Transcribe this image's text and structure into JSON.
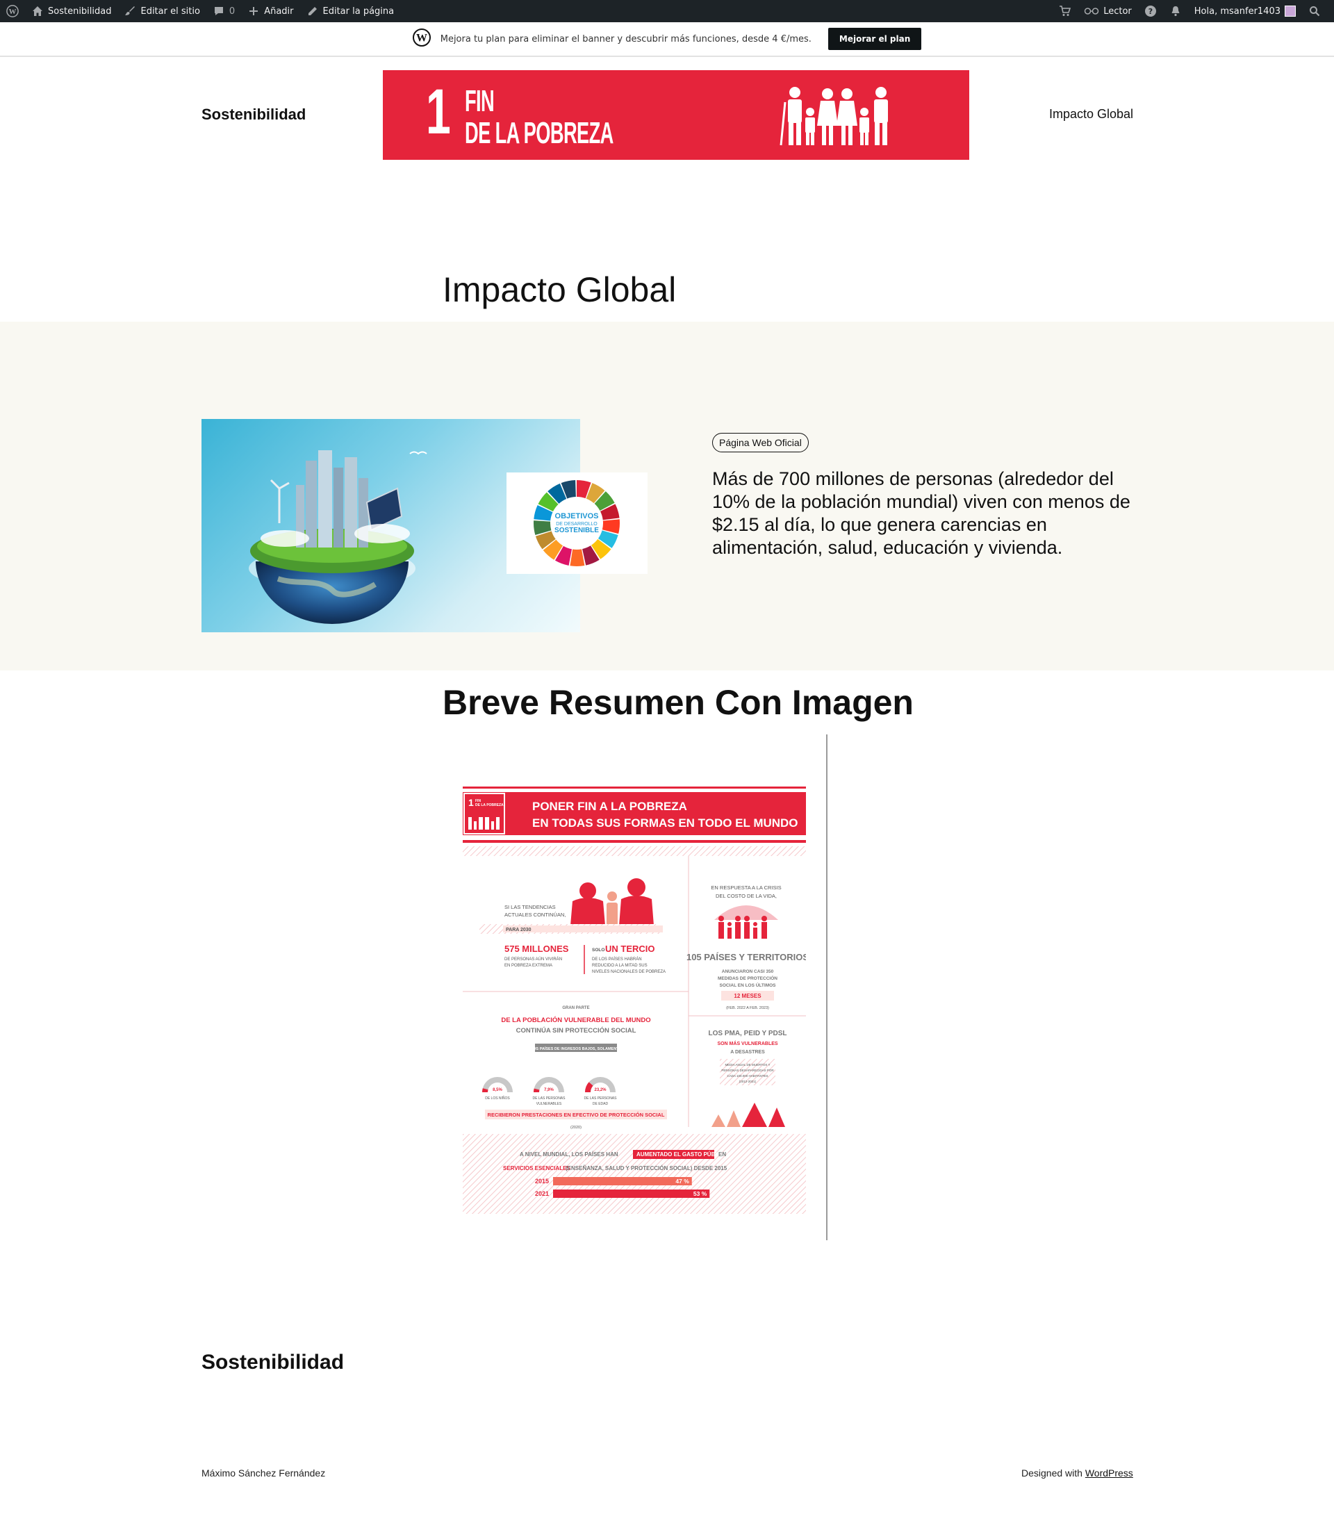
{
  "admin_bar": {
    "site": "Sostenibilidad",
    "edit_site": "Editar el sitio",
    "comments_count": "0",
    "add_new": "Añadir",
    "edit_page": "Editar la página",
    "reader": "Lector",
    "greeting": "Hola, msanfer1403"
  },
  "upgrade_banner": {
    "text": "Mejora tu plan para eliminar el banner y descubrir más funciones, desde 4 €/mes.",
    "button": "Mejorar el plan"
  },
  "header": {
    "site_title": "Sostenibilidad",
    "banner_number": "1",
    "banner_line1": "FIN",
    "banner_line2": "DE LA POBREZA",
    "banner_color": "#e5243b",
    "nav_link": "Impacto Global"
  },
  "page": {
    "title": "Impacto Global",
    "badge": "Página Web Oficial",
    "lead": "Más de 700 millones de personas (alrededor del 10% de la población mundial) viven con menos de $2.15 al día, lo que genera carencias en alimentación, salud, educación y vivienda.",
    "sdg_logo_line1": "OBJETIVOS",
    "sdg_logo_line2": "DE DESARROLLO",
    "sdg_logo_line3": "SOSTENIBLE"
  },
  "section2": {
    "title": "Breve Resumen Con Imagen"
  },
  "infographic": {
    "badge_num": "1",
    "badge_line1": "FIN",
    "badge_line2": "DE LA POBREZA",
    "header_line1": "PONER FIN A LA POBREZA",
    "header_line2": "EN TODAS SUS FORMAS EN TODO EL MUNDO",
    "trend_line1": "SI LAS TENDENCIAS",
    "trend_line2": "ACTUALES CONTINÚAN,",
    "para_2030": "PARA 2030",
    "million_575": "575 MILLONES",
    "million_575_sub1": "DE PERSONAS AÚN VIVIRÁN",
    "million_575_sub2": "EN POBREZA EXTREMA",
    "solo": "SOLO",
    "tercio": "UN TERCIO",
    "tercio_sub1": "DE LOS PAÍSES HABRÁN",
    "tercio_sub2": "REDUCIDO A LA MITAD SUS",
    "tercio_sub3": "NIVELES NACIONALES DE POBREZA",
    "crisis_line1": "EN RESPUESTA A LA CRISIS",
    "crisis_line2": "DEL COSTO DE LA VIDA,",
    "countries": "105 PAÍSES Y TERRITORIOS",
    "measures1": "ANUNCIARON  CASI  350",
    "measures2": "MEDIDAS DE PROTECCIÓN",
    "measures3": "SOCIAL  EN  LOS  ÚLTIMOS",
    "months": "12 MESES",
    "months_period": "(FEB. 2022 A FEB. 2023)",
    "gran_parte": "GRAN PARTE",
    "vulnerable_line1": "DE LA POBLACIÓN VULNERABLE DEL MUNDO",
    "vulnerable_line2": "CONTINÚA SIN PROTECCIÓN SOCIAL",
    "low_income": "LOS PAÍSES DE INGRESOS BAJOS, SOLAMENTE",
    "gauges": [
      {
        "value": "8,5%",
        "label": "DE LOS NIÑOS",
        "fraction": 0.085
      },
      {
        "value": "7,9%",
        "label": "DE LAS PERSONAS VULNERABLES",
        "fraction": 0.079
      },
      {
        "value": "23,2%",
        "label": "DE LAS PERSONAS DE EDAD",
        "fraction": 0.232
      }
    ],
    "received": "RECIBIERON PRESTACIONES EN EFECTIVO DE PROTECCIÓN SOCIAL",
    "received_year": "(2020)",
    "pma_line1": "LOS PMA, PEID Y PDSL",
    "pma_line2": "SON MÁS VULNERABLES",
    "pma_line3": "A DESASTRES",
    "pma_note1": "MEDIA ANUAL DE MUERTOS Y",
    "pma_note2": "PERSONAS DESAPARECIDAS POR",
    "pma_note3": "CADA 100.000 HABITANTES",
    "pma_note4": "(2012-2021)",
    "spending_line1a": "A NIVEL MUNDIAL, LOS PAÍSES HAN",
    "spending_highlight": "AUMENTADO EL GASTO PÚBLICO",
    "spending_line1b": "EN",
    "spending_line2a": "SERVICIOS ESENCIALES",
    "spending_line2b": "(ENSEÑANZA, SALUD Y PROTECCIÓN SOCIAL) DESDE 2015",
    "bars": [
      {
        "year": "2015",
        "value": "47 %",
        "pct": 47
      },
      {
        "year": "2021",
        "value": "53 %",
        "pct": 53
      }
    ]
  },
  "footer": {
    "title": "Sostenibilidad",
    "author": "Máximo Sánchez Fernández",
    "designed_prefix": "Designed with",
    "designed_link": "WordPress"
  }
}
